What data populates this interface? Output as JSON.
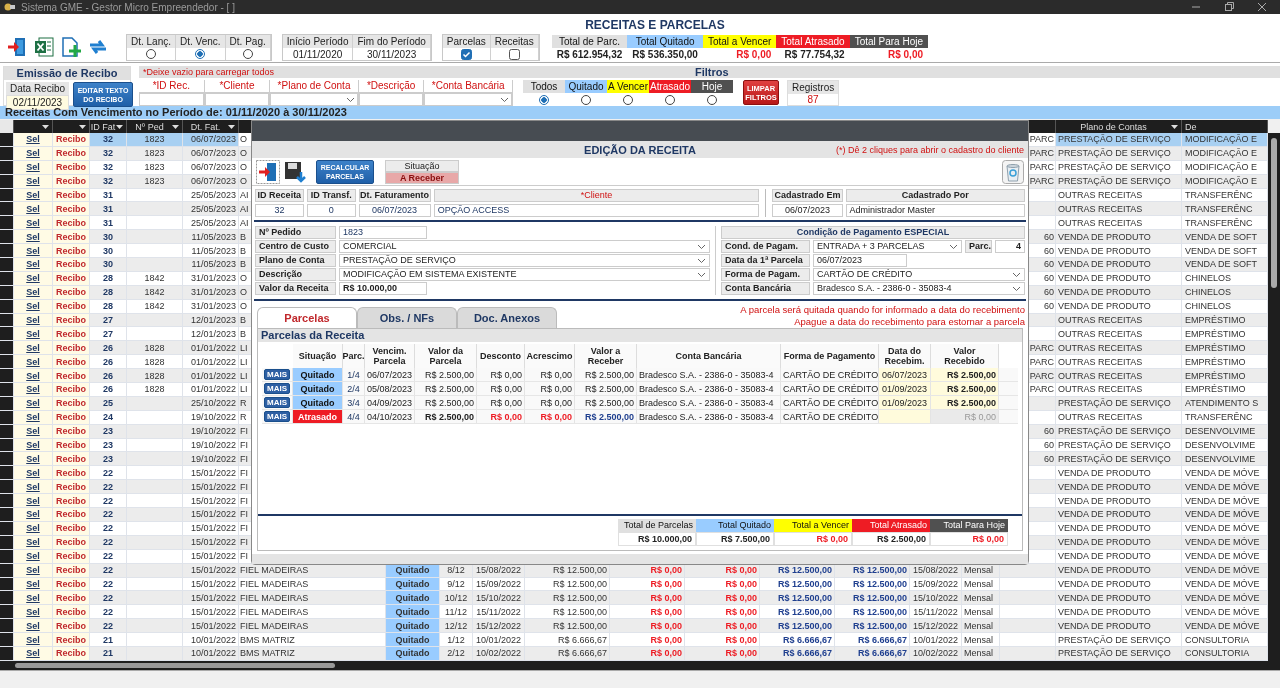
{
  "window": {
    "title": "Sistema GME - Gestor Micro Empreendedor - [ ]"
  },
  "page_title": "RECEITAS E PARCELAS",
  "date_filter": [
    {
      "label": "Dt. Lanç.",
      "selected": false
    },
    {
      "label": "Dt. Venc.",
      "selected": true
    },
    {
      "label": "Dt. Pag.",
      "selected": false
    }
  ],
  "period": [
    {
      "label": "Início Período",
      "value": "01/11/2020"
    },
    {
      "label": "Fim do Período",
      "value": "30/11/2023"
    }
  ],
  "show": [
    {
      "label": "Parcelas",
      "checked": true
    },
    {
      "label": "Receitas",
      "checked": false
    }
  ],
  "totals": [
    {
      "kind": "total",
      "label": "Total de Parc.",
      "value": "R$ 612.954,32"
    },
    {
      "kind": "quitado",
      "label": "Total Quitado",
      "value": "R$ 536.350,00"
    },
    {
      "kind": "vencer",
      "label": "Total a Vencer",
      "value": "R$ 0,00"
    },
    {
      "kind": "atrasado",
      "label": "Total Atrasado",
      "value": "R$ 77.754,32"
    },
    {
      "kind": "hoje",
      "label": "Total Para Hoje",
      "value": "R$ 0,00"
    }
  ],
  "receipt": {
    "title": "Emissão de Recibo",
    "date_label": "Data Recibo",
    "date": "02/11/2023",
    "button": "EDITAR TEXTO DO RECIBO"
  },
  "filters": {
    "note": "*Deixe vazio para carregar todos",
    "title": "Filtros",
    "fields": [
      {
        "label": "*ID Rec.",
        "dropdown": false
      },
      {
        "label": "*Cliente",
        "dropdown": false
      },
      {
        "label": "*Plano de Conta",
        "dropdown": true
      },
      {
        "label": "*Descrição",
        "dropdown": false
      },
      {
        "label": "*Conta Bancária",
        "dropdown": true
      }
    ],
    "status": [
      {
        "kind": "total",
        "label": "Todos",
        "selected": true
      },
      {
        "kind": "quitado",
        "label": "Quitado",
        "selected": false
      },
      {
        "kind": "vencer",
        "label": "A Vencer",
        "selected": false
      },
      {
        "kind": "atrasado",
        "label": "Atrasado",
        "selected": false
      },
      {
        "kind": "hoje",
        "label": "Hoje",
        "selected": false
      }
    ],
    "clear_button": "LIMPAR FILTROS",
    "count_label": "Registros",
    "count": "87"
  },
  "period_banner": "Receitas Com Vencimento no Período de: 01/11/2020 à 30/11/2023",
  "table": {
    "columns": [
      "ID Fat",
      "Nº Ped",
      "Dt. Fat.",
      "Plano de Contas",
      "De"
    ],
    "rows": [
      {
        "sel": "Sel",
        "recibo": "Recibo",
        "id": "32",
        "ped": "1823",
        "dt": "06/07/2023",
        "cliente": "O",
        "tipo": "PARC",
        "plano": "PRESTAÇÃO DE SERVIÇO",
        "desc": "MODIFICAÇÃO E",
        "selected": true
      },
      {
        "sel": "Sel",
        "recibo": "Recibo",
        "id": "32",
        "ped": "1823",
        "dt": "06/07/2023",
        "cliente": "O",
        "tipo": "PARC",
        "plano": "PRESTAÇÃO DE SERVIÇO",
        "desc": "MODIFICAÇÃO E",
        "selected": false
      },
      {
        "sel": "Sel",
        "recibo": "Recibo",
        "id": "32",
        "ped": "1823",
        "dt": "06/07/2023",
        "cliente": "O",
        "tipo": "PARC",
        "plano": "PRESTAÇÃO DE SERVIÇO",
        "desc": "MODIFICAÇÃO E",
        "selected": false
      },
      {
        "sel": "Sel",
        "recibo": "Recibo",
        "id": "32",
        "ped": "1823",
        "dt": "06/07/2023",
        "cliente": "O",
        "tipo": "PARC",
        "plano": "PRESTAÇÃO DE SERVIÇO",
        "desc": "MODIFICAÇÃO E",
        "selected": false
      },
      {
        "sel": "Sel",
        "recibo": "Recibo",
        "id": "31",
        "dt": "25/05/2023",
        "cliente": "AI",
        "plano": "OUTRAS RECEITAS",
        "desc": "TRANSFERÊNC",
        "selected": false
      },
      {
        "sel": "Sel",
        "recibo": "Recibo",
        "id": "31",
        "dt": "25/05/2023",
        "cliente": "AI",
        "plano": "OUTRAS RECEITAS",
        "desc": "TRANSFERÊNC",
        "selected": false
      },
      {
        "sel": "Sel",
        "recibo": "Recibo",
        "id": "31",
        "dt": "25/05/2023",
        "cliente": "AI",
        "plano": "OUTRAS RECEITAS",
        "desc": "TRANSFERÊNC",
        "selected": false
      },
      {
        "sel": "Sel",
        "recibo": "Recibo",
        "id": "30",
        "dt": "11/05/2023",
        "cliente": "B",
        "tipo": "60",
        "plano": "VENDA DE PRODUTO",
        "desc": "VENDA DE SOFT",
        "selected": false
      },
      {
        "sel": "Sel",
        "recibo": "Recibo",
        "id": "30",
        "dt": "11/05/2023",
        "cliente": "B",
        "tipo": "60",
        "plano": "VENDA DE PRODUTO",
        "desc": "VENDA DE SOFT",
        "selected": false
      },
      {
        "sel": "Sel",
        "recibo": "Recibo",
        "id": "30",
        "dt": "11/05/2023",
        "cliente": "B",
        "tipo": "60",
        "plano": "VENDA DE PRODUTO",
        "desc": "VENDA DE SOFT",
        "selected": false
      },
      {
        "sel": "Sel",
        "recibo": "Recibo",
        "id": "28",
        "ped": "1842",
        "dt": "31/01/2023",
        "cliente": "O",
        "tipo": "60",
        "plano": "VENDA DE PRODUTO",
        "desc": "CHINELOS",
        "selected": false
      },
      {
        "sel": "Sel",
        "recibo": "Recibo",
        "id": "28",
        "ped": "1842",
        "dt": "31/01/2023",
        "cliente": "O",
        "tipo": "60",
        "plano": "VENDA DE PRODUTO",
        "desc": "CHINELOS",
        "selected": false
      },
      {
        "sel": "Sel",
        "recibo": "Recibo",
        "id": "28",
        "ped": "1842",
        "dt": "31/01/2023",
        "cliente": "O",
        "tipo": "60",
        "plano": "VENDA DE PRODUTO",
        "desc": "CHINELOS",
        "selected": false
      },
      {
        "sel": "Sel",
        "recibo": "Recibo",
        "id": "27",
        "dt": "12/01/2023",
        "cliente": "B",
        "plano": "OUTRAS RECEITAS",
        "desc": "EMPRÉSTIMO",
        "selected": false
      },
      {
        "sel": "Sel",
        "recibo": "Recibo",
        "id": "27",
        "dt": "12/01/2023",
        "cliente": "B",
        "plano": "OUTRAS RECEITAS",
        "desc": "EMPRÉSTIMO",
        "selected": false
      },
      {
        "sel": "Sel",
        "recibo": "Recibo",
        "id": "26",
        "ped": "1828",
        "dt": "01/01/2022",
        "cliente": "LI",
        "tipo": "PARC",
        "plano": "OUTRAS RECEITAS",
        "desc": "EMPRÉSTIMO",
        "selected": false
      },
      {
        "sel": "Sel",
        "recibo": "Recibo",
        "id": "26",
        "ped": "1828",
        "dt": "01/01/2022",
        "cliente": "LI",
        "tipo": "PARC",
        "plano": "OUTRAS RECEITAS",
        "desc": "EMPRÉSTIMO",
        "selected": false
      },
      {
        "sel": "Sel",
        "recibo": "Recibo",
        "id": "26",
        "ped": "1828",
        "dt": "01/01/2022",
        "cliente": "LI",
        "tipo": "PARC",
        "plano": "OUTRAS RECEITAS",
        "desc": "EMPRÉSTIMO",
        "selected": false
      },
      {
        "sel": "Sel",
        "recibo": "Recibo",
        "id": "26",
        "ped": "1828",
        "dt": "01/01/2022",
        "cliente": "LI",
        "tipo": "PARC",
        "plano": "OUTRAS RECEITAS",
        "desc": "EMPRÉSTIMO",
        "selected": false
      },
      {
        "sel": "Sel",
        "recibo": "Recibo",
        "id": "25",
        "dt": "25/10/2022",
        "cliente": "R",
        "plano": "PRESTAÇÃO DE SERVIÇO",
        "desc": "ATENDIMENTO S",
        "selected": false
      },
      {
        "sel": "Sel",
        "recibo": "Recibo",
        "id": "24",
        "dt": "19/10/2022",
        "cliente": "R",
        "plano": "OUTRAS RECEITAS",
        "desc": "TRANSFERÊNC",
        "selected": false
      },
      {
        "sel": "Sel",
        "recibo": "Recibo",
        "id": "23",
        "dt": "19/10/2022",
        "cliente": "FI",
        "tipo": "60",
        "plano": "PRESTAÇÃO DE SERVIÇO",
        "desc": "DESENVOLVIME",
        "selected": false
      },
      {
        "sel": "Sel",
        "recibo": "Recibo",
        "id": "23",
        "dt": "19/10/2022",
        "cliente": "FI",
        "tipo": "60",
        "plano": "PRESTAÇÃO DE SERVIÇO",
        "desc": "DESENVOLVIME",
        "selected": false
      },
      {
        "sel": "Sel",
        "recibo": "Recibo",
        "id": "23",
        "dt": "19/10/2022",
        "cliente": "FI",
        "tipo": "60",
        "plano": "PRESTAÇÃO DE SERVIÇO",
        "desc": "DESENVOLVIME",
        "selected": false
      },
      {
        "sel": "Sel",
        "recibo": "Recibo",
        "id": "22",
        "dt": "15/01/2022",
        "cliente": "FI",
        "plano": "VENDA DE PRODUTO",
        "desc": "VENDA DE MÓVE",
        "selected": false
      },
      {
        "sel": "Sel",
        "recibo": "Recibo",
        "id": "22",
        "dt": "15/01/2022",
        "cliente": "FI",
        "plano": "VENDA DE PRODUTO",
        "desc": "VENDA DE MÓVE",
        "selected": false
      },
      {
        "sel": "Sel",
        "recibo": "Recibo",
        "id": "22",
        "dt": "15/01/2022",
        "cliente": "FI",
        "plano": "VENDA DE PRODUTO",
        "desc": "VENDA DE MÓVE",
        "selected": false
      },
      {
        "sel": "Sel",
        "recibo": "Recibo",
        "id": "22",
        "dt": "15/01/2022",
        "cliente": "FI",
        "plano": "VENDA DE PRODUTO",
        "desc": "VENDA DE MÓVE",
        "selected": false
      },
      {
        "sel": "Sel",
        "recibo": "Recibo",
        "id": "22",
        "dt": "15/01/2022",
        "cliente": "FI",
        "plano": "VENDA DE PRODUTO",
        "desc": "VENDA DE MÓVE",
        "selected": false
      },
      {
        "sel": "Sel",
        "recibo": "Recibo",
        "id": "22",
        "dt": "15/01/2022",
        "cliente": "FI",
        "plano": "VENDA DE PRODUTO",
        "desc": "VENDA DE MÓVE",
        "selected": false
      },
      {
        "sel": "Sel",
        "recibo": "Recibo",
        "id": "22",
        "dt": "15/01/2022",
        "cliente": "FI",
        "plano": "VENDA DE PRODUTO",
        "desc": "VENDA DE MÓVE",
        "selected": false
      },
      {
        "sel": "Sel",
        "recibo": "Recibo",
        "id": "22",
        "dt": "15/01/2022",
        "cliente": "FIEL MADEIRAS",
        "situacao": "Quitado",
        "kind": "quitado",
        "parcela": "8/12",
        "venc": "15/08/2022",
        "valor": "R$ 12.500,00",
        "desconto": "R$ 0,00",
        "acrescimo": "R$ 0,00",
        "a_receber": "R$ 12.500,00",
        "recebido": "R$ 12.500,00",
        "data_receb": "15/08/2022",
        "freq": "Mensal",
        "plano": "VENDA DE PRODUTO",
        "desc": "VENDA DE MÓVE",
        "selected": false
      },
      {
        "sel": "Sel",
        "recibo": "Recibo",
        "id": "22",
        "dt": "15/01/2022",
        "cliente": "FIEL MADEIRAS",
        "situacao": "Quitado",
        "kind": "quitado",
        "parcela": "9/12",
        "venc": "15/09/2022",
        "valor": "R$ 12.500,00",
        "desconto": "R$ 0,00",
        "acrescimo": "R$ 0,00",
        "a_receber": "R$ 12.500,00",
        "recebido": "R$ 12.500,00",
        "data_receb": "15/09/2022",
        "freq": "Mensal",
        "plano": "VENDA DE PRODUTO",
        "desc": "VENDA DE MÓVE",
        "selected": false
      },
      {
        "sel": "Sel",
        "recibo": "Recibo",
        "id": "22",
        "dt": "15/01/2022",
        "cliente": "FIEL MADEIRAS",
        "situacao": "Quitado",
        "kind": "quitado",
        "parcela": "10/12",
        "venc": "15/10/2022",
        "valor": "R$ 12.500,00",
        "desconto": "R$ 0,00",
        "acrescimo": "R$ 0,00",
        "a_receber": "R$ 12.500,00",
        "recebido": "R$ 12.500,00",
        "data_receb": "15/10/2022",
        "freq": "Mensal",
        "plano": "VENDA DE PRODUTO",
        "desc": "VENDA DE MÓVE",
        "selected": false
      },
      {
        "sel": "Sel",
        "recibo": "Recibo",
        "id": "22",
        "dt": "15/01/2022",
        "cliente": "FIEL MADEIRAS",
        "situacao": "Quitado",
        "kind": "quitado",
        "parcela": "11/12",
        "venc": "15/11/2022",
        "valor": "R$ 12.500,00",
        "desconto": "R$ 0,00",
        "acrescimo": "R$ 0,00",
        "a_receber": "R$ 12.500,00",
        "recebido": "R$ 12.500,00",
        "data_receb": "15/11/2022",
        "freq": "Mensal",
        "plano": "VENDA DE PRODUTO",
        "desc": "VENDA DE MÓVE",
        "selected": false
      },
      {
        "sel": "Sel",
        "recibo": "Recibo",
        "id": "22",
        "dt": "15/01/2022",
        "cliente": "FIEL MADEIRAS",
        "situacao": "Quitado",
        "kind": "quitado",
        "parcela": "12/12",
        "venc": "15/12/2022",
        "valor": "R$ 12.500,00",
        "desconto": "R$ 0,00",
        "acrescimo": "R$ 0,00",
        "a_receber": "R$ 12.500,00",
        "recebido": "R$ 12.500,00",
        "data_receb": "15/12/2022",
        "freq": "Mensal",
        "plano": "VENDA DE PRODUTO",
        "desc": "VENDA DE MÓVE",
        "selected": false
      },
      {
        "sel": "Sel",
        "recibo": "Recibo",
        "id": "21",
        "dt": "10/01/2022",
        "cliente": "BMS MATRIZ",
        "situacao": "Quitado",
        "kind": "quitado",
        "parcela": "1/12",
        "venc": "10/01/2022",
        "valor": "R$ 6.666,67",
        "desconto": "R$ 0,00",
        "acrescimo": "R$ 0,00",
        "a_receber": "R$ 6.666,67",
        "recebido": "R$ 6.666,67",
        "data_receb": "10/01/2022",
        "freq": "Mensal",
        "plano": "PRESTAÇÃO DE SERVIÇO",
        "desc": "CONSULTORIA",
        "selected": false
      },
      {
        "sel": "Sel",
        "recibo": "Recibo",
        "id": "21",
        "dt": "10/01/2022",
        "cliente": "BMS MATRIZ",
        "situacao": "Quitado",
        "kind": "quitado",
        "parcela": "2/12",
        "venc": "10/02/2022",
        "valor": "R$ 6.666,67",
        "desconto": "R$ 0,00",
        "acrescimo": "R$ 0,00",
        "a_receber": "R$ 6.666,67",
        "recebido": "R$ 6.666,67",
        "data_receb": "10/02/2022",
        "freq": "Mensal",
        "plano": "PRESTAÇÃO DE SERVIÇO",
        "desc": "CONSULTORIA",
        "selected": false
      }
    ]
  },
  "modal": {
    "title": "EDIÇÃO DA RECEITA",
    "hint": "(*) Dê 2 cliques para abrir o cadastro do cliente",
    "recalc_button": "RECALCULAR PARCELAS",
    "status_label": "Situação",
    "status": "A Receber",
    "ids": [
      {
        "label": "ID Receita",
        "value": "32"
      },
      {
        "label": "ID Transf.",
        "value": "0"
      },
      {
        "label": "Dt. Faturamento",
        "value": "06/07/2023"
      }
    ],
    "client": {
      "label": "*Cliente",
      "value": "OPÇÃO ACCESS"
    },
    "registered": [
      {
        "label": "Cadastrado Em",
        "value": "06/07/2023"
      },
      {
        "label": "Cadastrado Por",
        "value": "Administrador Master"
      }
    ],
    "form": [
      {
        "kind": "number",
        "label": "Nº Pedido",
        "value": "1823"
      },
      {
        "kind": "select",
        "label": "Centro de Custo",
        "value": "COMERCIAL"
      },
      {
        "kind": "select",
        "label": "Plano de Conta",
        "value": "PRESTAÇÃO DE SERVIÇO"
      },
      {
        "kind": "select",
        "label": "Descrição",
        "value": "MODIFICAÇÃO EM SISTEMA EXISTENTE"
      },
      {
        "kind": "money",
        "label": "Valor da Receita",
        "value": "R$ 10.000,00"
      }
    ],
    "payment_title": "Condição de Pagamento ESPECIAL",
    "payment": [
      {
        "kind": "select",
        "label": "Cond. de Pagam.",
        "value": "ENTRADA + 3 PARCELAS",
        "parc_label": "Parc.",
        "parc": "4"
      },
      {
        "kind": "short",
        "label": "Data da 1ª Parcela",
        "value": "06/07/2023"
      },
      {
        "kind": "select",
        "label": "Forma de Pagam.",
        "value": "CARTÃO DE CRÉDITO"
      },
      {
        "kind": "select",
        "label": "Conta Bancária",
        "value": "Bradesco S.A. - 2386-0 - 35083-4"
      }
    ],
    "tabs": [
      {
        "label": "Parcelas",
        "selected": true
      },
      {
        "label": "Obs. / NFs",
        "selected": false
      },
      {
        "label": "Doc. Anexos",
        "selected": false
      }
    ],
    "notes": [
      "A parcela será quitada quando for informado a data do recebimento",
      "Apague a data do recebimento para estornar a parcela"
    ],
    "panel_title": "Parcelas da Receita",
    "columns": [
      "Situação",
      "Parc.",
      "Vencim. Parcela",
      "Valor da Parcela",
      "Desconto",
      "Acrescimo",
      "Valor a Receber",
      "Conta Bancária",
      "Forma de Pagamento",
      "Data do Recebim.",
      "Valor Recebido"
    ],
    "rows": [
      {
        "button": "MAIS",
        "kind": "quitado",
        "situacao": "Quitado",
        "parcela": "1/4",
        "venc": "06/07/2023",
        "valor": "R$ 2.500,00",
        "desconto": "R$ 0,00",
        "acrescimo": "R$ 0,00",
        "a_receber": "R$ 2.500,00",
        "conta": "Bradesco S.A. - 2386-0 - 35083-4",
        "forma": "CARTÃO DE CRÉDITO",
        "data_receb": "06/07/2023",
        "recebido": "R$ 2.500,00"
      },
      {
        "button": "MAIS",
        "kind": "quitado",
        "situacao": "Quitado",
        "parcela": "2/4",
        "venc": "05/08/2023",
        "valor": "R$ 2.500,00",
        "desconto": "R$ 0,00",
        "acrescimo": "R$ 0,00",
        "a_receber": "R$ 2.500,00",
        "conta": "Bradesco S.A. - 2386-0 - 35083-4",
        "forma": "CARTÃO DE CRÉDITO",
        "data_receb": "01/09/2023",
        "recebido": "R$ 2.500,00"
      },
      {
        "button": "MAIS",
        "kind": "quitado",
        "situacao": "Quitado",
        "parcela": "3/4",
        "venc": "04/09/2023",
        "valor": "R$ 2.500,00",
        "desconto": "R$ 0,00",
        "acrescimo": "R$ 0,00",
        "a_receber": "R$ 2.500,00",
        "conta": "Bradesco S.A. - 2386-0 - 35083-4",
        "forma": "CARTÃO DE CRÉDITO",
        "data_receb": "01/09/2023",
        "recebido": "R$ 2.500,00"
      },
      {
        "button": "MAIS",
        "kind": "atrasado",
        "situacao": "Atrasado",
        "parcela": "4/4",
        "venc": "04/10/2023",
        "valor": "R$ 2.500,00",
        "desconto": "R$ 0,00",
        "acrescimo": "R$ 0,00",
        "a_receber": "R$ 2.500,00",
        "conta": "Bradesco S.A. - 2386-0 - 35083-4",
        "forma": "CARTÃO DE CRÉDITO",
        "recebido": "R$ 0,00"
      }
    ],
    "totals": [
      {
        "kind": "total",
        "label": "Total de Parcelas",
        "value": "R$ 10.000,00"
      },
      {
        "kind": "quitado",
        "label": "Total Quitado",
        "value": "R$ 7.500,00"
      },
      {
        "kind": "vencer",
        "label": "Total a Vencer",
        "value": "R$ 0,00"
      },
      {
        "kind": "atrasado",
        "label": "Total Atrasado",
        "value": "R$ 2.500,00"
      },
      {
        "kind": "hoje",
        "label": "Total Para Hoje",
        "value": "R$ 0,00"
      }
    ]
  }
}
